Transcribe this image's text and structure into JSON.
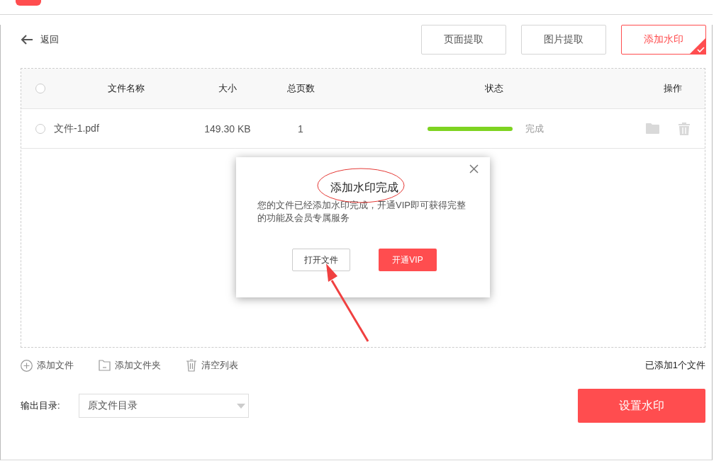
{
  "back": {
    "label": "返回"
  },
  "tabs": [
    {
      "label": "页面提取",
      "selected": false
    },
    {
      "label": "图片提取",
      "selected": false
    },
    {
      "label": "添加水印",
      "selected": true
    }
  ],
  "table": {
    "header_checked": false,
    "columns": [
      "文件名称",
      "大小",
      "总页数",
      "状态",
      "操作"
    ],
    "rows": [
      {
        "checked": false,
        "name": "文件-1.pdf",
        "size": "149.30 KB",
        "pages": "1",
        "level": 1,
        "status": "完成"
      }
    ]
  },
  "toolbar": [
    {
      "kind": "add-file",
      "label": "添加文件"
    },
    {
      "kind": "add-folder",
      "label": "添加文件夹"
    },
    {
      "kind": "clear",
      "label": "清空列表"
    }
  ],
  "file_count": "已添加1个文件",
  "output": {
    "label": "输出目录:",
    "value": "原文件目录"
  },
  "primary_button": "设置水印",
  "dialog": {
    "title": "添加水印完成",
    "message": "您的文件已经添加水印完成，开通VIP即可获得完整的功能及会员专属服务",
    "buttons": [
      {
        "kind": "secondary",
        "label": "打开文件"
      },
      {
        "kind": "primary",
        "label": "开通VIP"
      }
    ]
  }
}
